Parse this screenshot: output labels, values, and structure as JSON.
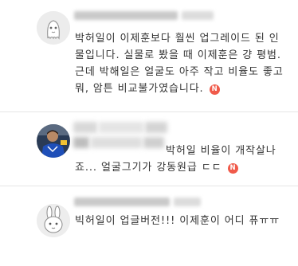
{
  "comments": [
    {
      "avatar_icon": "ghost-doodle-avatar",
      "lines": [
        "박허일이 이제훈보다 훨씬 업그레이드 된 인",
        "물입니다. 실물로 봤을 때 이제훈은 걍 평범.",
        "근데 박해일은 얼굴도 아주 작고 비율도 좋고",
        "뭐, 암튼 비교불가였습니다."
      ],
      "badge": "N"
    },
    {
      "avatar_icon": "soccer-player-photo-avatar",
      "lines": [
        "박허일 비율이 개작살나",
        "죠... 얼굴그기가 강동원급 ㄷㄷ"
      ],
      "badge": "N"
    },
    {
      "avatar_icon": "bunny-doodle-avatar",
      "lines": [
        "빅허일이 업글버전!!! 이제훈이 어디 퓨ㅠㅠ"
      ],
      "badge": ""
    }
  ],
  "colors": {
    "badge": "#f05a4a",
    "text": "#333333",
    "divider": "#e6e6e6",
    "blurred_meta": "#c9c9c9"
  }
}
